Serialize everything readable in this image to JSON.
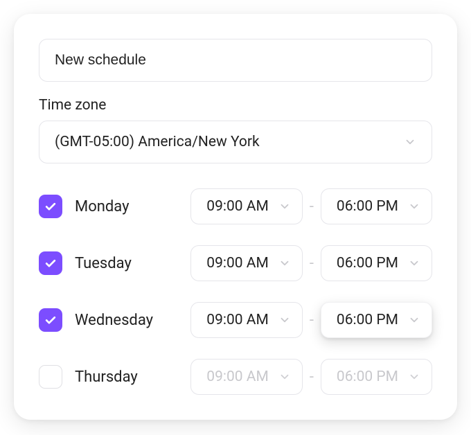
{
  "schedule_name": "New schedule",
  "timezone": {
    "label": "Time zone",
    "value": "(GMT-05:00) America/New York"
  },
  "time_separator": "-",
  "colors": {
    "accent": "#7c4dff"
  },
  "days": [
    {
      "name": "Monday",
      "checked": true,
      "start": "09:00 AM",
      "end": "06:00 PM",
      "start_elevated": false,
      "end_elevated": false
    },
    {
      "name": "Tuesday",
      "checked": true,
      "start": "09:00 AM",
      "end": "06:00 PM",
      "start_elevated": false,
      "end_elevated": false
    },
    {
      "name": "Wednesday",
      "checked": true,
      "start": "09:00 AM",
      "end": "06:00 PM",
      "start_elevated": false,
      "end_elevated": true
    },
    {
      "name": "Thursday",
      "checked": false,
      "start": "09:00 AM",
      "end": "06:00 PM",
      "start_elevated": false,
      "end_elevated": false
    }
  ]
}
